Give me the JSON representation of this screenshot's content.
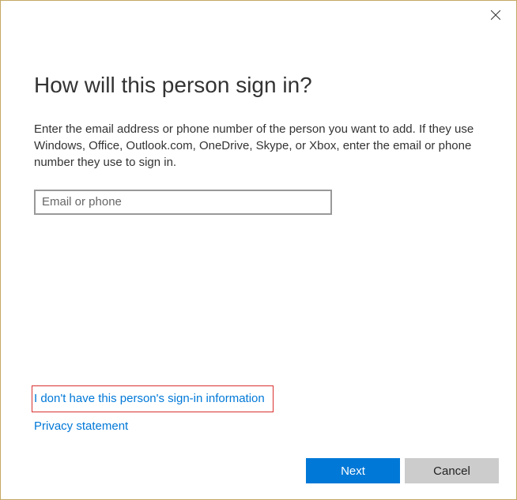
{
  "dialog": {
    "title": "How will this person sign in?",
    "description": "Enter the email address or phone number of the person you want to add. If they use Windows, Office, Outlook.com, OneDrive, Skype, or Xbox, enter the email or phone number they use to sign in.",
    "input": {
      "placeholder": "Email or phone",
      "value": ""
    },
    "links": {
      "no_signin_info": "I don't have this person's sign-in information",
      "privacy": "Privacy statement"
    },
    "buttons": {
      "next": "Next",
      "cancel": "Cancel"
    }
  }
}
